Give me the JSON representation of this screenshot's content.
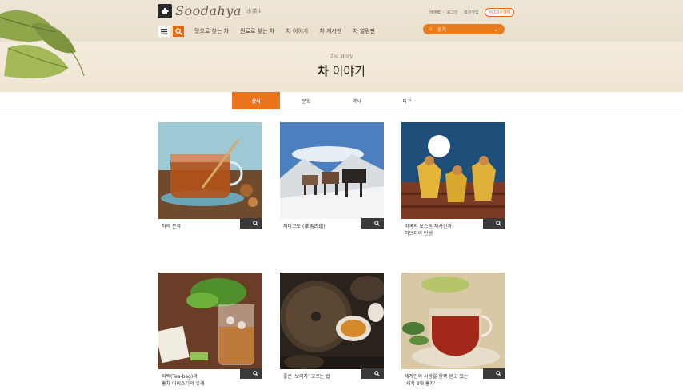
{
  "brand": {
    "logo_text": "Soodahya",
    "logo_sub": "水茶↓"
  },
  "top_links": {
    "home": "HOME",
    "login": "로그인",
    "join": "회원가입",
    "member_button": "수다회원결제"
  },
  "nav": {
    "items": [
      "맛으로 찾는 차",
      "원료로 찾는 차",
      "차 이야기",
      "차 게시판",
      "차 알림판"
    ]
  },
  "weather": {
    "num": "2",
    "label": "경기"
  },
  "band": {
    "subtitle": "Tea story",
    "title_bold": "차",
    "title_light": " 이야기"
  },
  "tabs": [
    {
      "label": "상식",
      "active": true
    },
    {
      "label": "문화",
      "active": false
    },
    {
      "label": "역사",
      "active": false
    },
    {
      "label": "다구",
      "active": false
    }
  ],
  "cards": [
    {
      "caption_line1": "차의 분류",
      "caption_line2": ""
    },
    {
      "caption_line1": "차마고도 (茶馬古道)",
      "caption_line2": ""
    },
    {
      "caption_line1": "미국의 보스톤 차사건과",
      "caption_line2": "허브차의 탄생"
    },
    {
      "caption_line1": "티백(Tea-bag)과",
      "caption_line2": "홍차 아이스티의 유래"
    },
    {
      "caption_line1": "좋은 '보이차' 고르는 법",
      "caption_line2": ""
    },
    {
      "caption_line1": "세계인의 사랑을 한뿍 받고 있는",
      "caption_line2": "'세계 3대 홍차'"
    }
  ],
  "colors": {
    "accent": "#e8731a",
    "header_bg": "#eee6d6",
    "dark": "#3a3a3a"
  }
}
